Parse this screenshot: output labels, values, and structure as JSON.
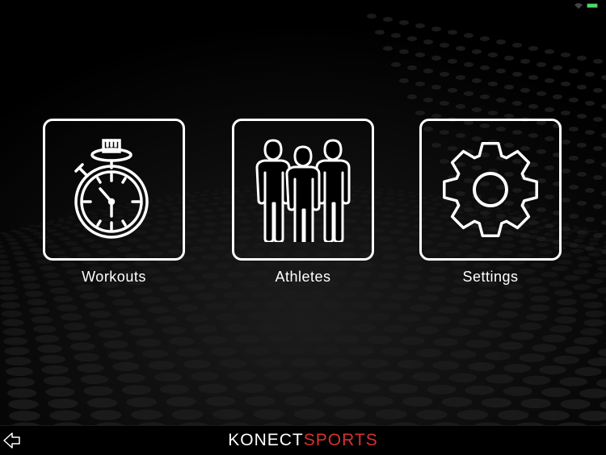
{
  "status": {
    "battery_level": 1.0,
    "battery_color": "#4cd964"
  },
  "tiles": [
    {
      "label": "Workouts",
      "icon": "stopwatch-icon"
    },
    {
      "label": "Athletes",
      "icon": "athletes-group-icon"
    },
    {
      "label": "Settings",
      "icon": "gear-icon"
    }
  ],
  "footer": {
    "back_icon": "back-arrow-icon",
    "logo_part1": "KONECT",
    "logo_part2": "SPORTS",
    "logo_accent_color": "#d8312f"
  }
}
